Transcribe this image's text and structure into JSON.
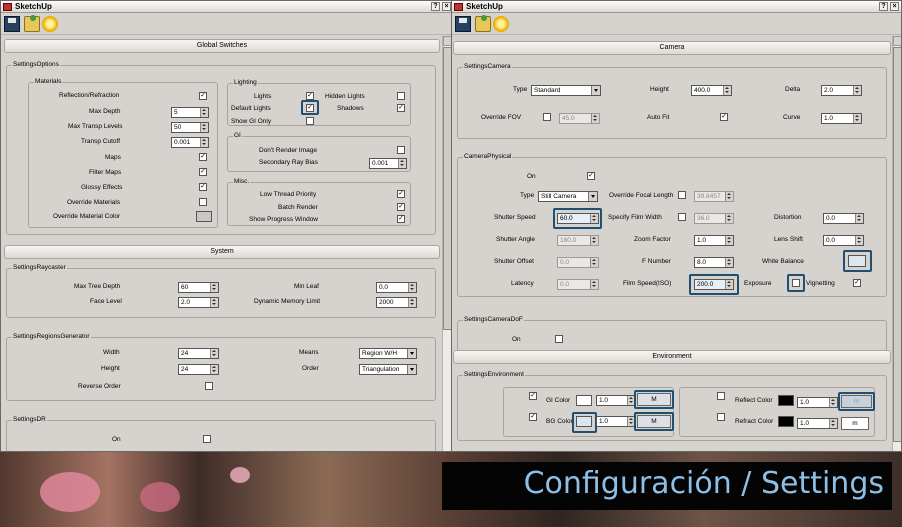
{
  "left_window": {
    "title": "SketchUp",
    "help_btn": "?",
    "close_btn": "×",
    "global_switches": {
      "header": "Global Switches",
      "settings_options": "SettingsOptions",
      "materials": {
        "title": "Materials",
        "reflection_refraction": "Reflection/Refraction",
        "max_depth": "Max Depth",
        "max_depth_val": "5",
        "max_transp_levels": "Max Transp Levels",
        "max_transp_levels_val": "50",
        "transp_cutoff": "Transp Cutoff",
        "transp_cutoff_val": "0.001",
        "maps": "Maps",
        "filter_maps": "Filter Maps",
        "glossy_effects": "Glossy Effects",
        "override_materials": "Override Materials",
        "override_material_color": "Override Material Color"
      },
      "lighting": {
        "title": "Lighting",
        "lights": "Lights",
        "hidden_lights": "Hidden Lights",
        "default_lights": "Default Lights",
        "shadows": "Shadows",
        "show_gi_only": "Show GI Only"
      },
      "gi": {
        "title": "GI",
        "dont_render_image": "Don't Render Image",
        "secondary_ray_bias": "Secondary Ray Bias",
        "secondary_ray_bias_val": "0.001"
      },
      "misc": {
        "title": "Misc.",
        "low_thread_priority": "Low Thread Priority",
        "batch_render": "Batch Render",
        "show_progress_window": "Show Progress Window"
      }
    },
    "system": {
      "header": "System",
      "raycaster": {
        "title": "SettingsRaycaster",
        "max_tree_depth": "Max Tree Depth",
        "max_tree_depth_val": "60",
        "min_leaf": "Min Leaf",
        "min_leaf_val": "0.0",
        "face_level": "Face Level",
        "face_level_val": "2.0",
        "dynamic_memory_limit": "Dynamic Memory Limit",
        "dynamic_memory_limit_val": "2000"
      },
      "regions": {
        "title": "SettingsRegionsGenerator",
        "width": "Width",
        "width_val": "24",
        "height": "Height",
        "height_val": "24",
        "means": "Means",
        "means_val": "Region W/H",
        "order": "Order",
        "order_val": "Triangulation",
        "reverse_order": "Reverse Order"
      },
      "dr": {
        "title": "SettingsDR",
        "on": "On"
      }
    }
  },
  "right_window": {
    "title": "SketchUp",
    "help_btn": "?",
    "close_btn": "×",
    "camera": {
      "header": "Camera",
      "settings_camera": {
        "title": "SettingsCamera",
        "type": "Type",
        "type_val": "Standard",
        "height": "Height",
        "height_val": "400.0",
        "delta": "Delta",
        "delta_val": "2.0",
        "override_fov": "Override FOV",
        "override_fov_val": "45.0",
        "auto_fit": "Auto Fit",
        "curve": "Curve",
        "curve_val": "1.0"
      },
      "physical": {
        "title": "CameraPhysical",
        "on": "On",
        "type": "Type",
        "type_val": "Still Camera",
        "override_focal_length": "Override Focal Length",
        "override_focal_length_val": "39.8457",
        "shutter_speed": "Shutter Speed",
        "shutter_speed_val": "60.0",
        "specify_film_width": "Specify Film Width",
        "specify_film_width_val": "36.0",
        "distortion": "Distortion",
        "distortion_val": "0.0",
        "shutter_angle": "Shutter Angle",
        "shutter_angle_val": "180.0",
        "zoom_factor": "Zoom Factor",
        "zoom_factor_val": "1.0",
        "lens_shift": "Lens Shift",
        "lens_shift_val": "0.0",
        "shutter_offset": "Shutter Offset",
        "shutter_offset_val": "0.0",
        "f_number": "F Number",
        "f_number_val": "8.0",
        "white_balance": "White Balance",
        "latency": "Latency",
        "latency_val": "0.0",
        "film_speed": "Film Speed(ISO)",
        "film_speed_val": "200.0",
        "exposure": "Exposure",
        "vignetting": "Vignetting"
      },
      "dof": {
        "title": "SettingsCameraDoF",
        "on": "On"
      }
    },
    "environment": {
      "header": "Environment",
      "title": "SettingsEnvironment",
      "gi_color": "GI Color",
      "gi_mult": "1.0",
      "gi_m": "M",
      "bg_color": "BG Color",
      "bg_mult": "1.0",
      "bg_m": "M",
      "reflect_color": "Reflect Color",
      "reflect_mult": "1.0",
      "reflect_m": "m",
      "refract_color": "Refract Color",
      "refract_mult": "1.0",
      "refract_m": "m"
    }
  },
  "caption": "Configuración / Settings",
  "colors": {
    "panel": "#d6d3ce",
    "highlight": "#1f4f73",
    "caption_text": "#8ebfe6",
    "override_swatch": "#c8c8c8",
    "white_balance": "#dfe6ee"
  },
  "icons": [
    "save-icon",
    "open-icon",
    "render-icon"
  ]
}
